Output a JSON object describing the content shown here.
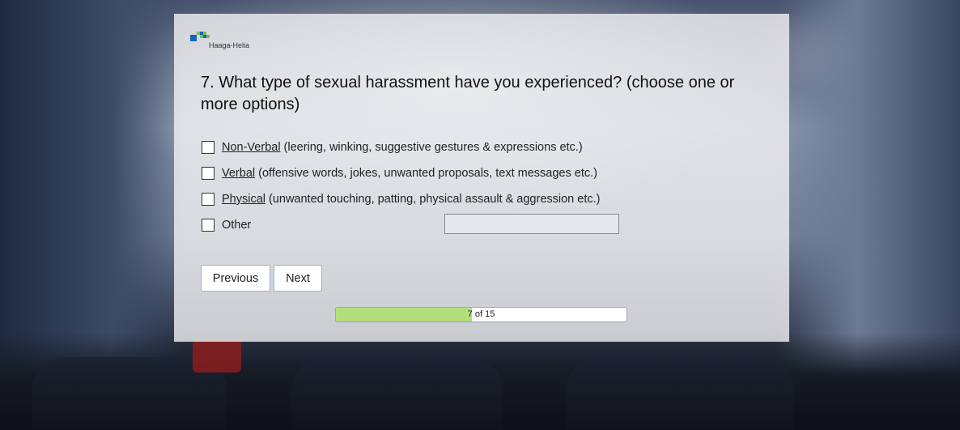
{
  "brand": {
    "name": "Haaga-Helia"
  },
  "question": {
    "text": "7. What type of sexual harassment have you experienced? (choose one or more options)"
  },
  "options": [
    {
      "term": "Non-Verbal",
      "description": "(leering, winking, suggestive gestures & expressions etc.)",
      "checked": false
    },
    {
      "term": "Verbal",
      "description": "(offensive words, jokes, unwanted proposals, text messages etc.)",
      "checked": false
    },
    {
      "term": "Physical",
      "description": "(unwanted touching, patting, physical assault & aggression etc.)",
      "checked": false
    },
    {
      "term": "",
      "description": "Other",
      "checked": false
    }
  ],
  "other_input": {
    "value": "",
    "placeholder": ""
  },
  "buttons": {
    "previous": "Previous",
    "next": "Next"
  },
  "progress": {
    "label": "7 of 15",
    "current": 7,
    "total": 15
  },
  "colors": {
    "progress_fill": "#b3de7e",
    "button_border": "#9bb3d1",
    "logo_blue": "#1565c0",
    "logo_green": "#7cc242"
  },
  "icons": {
    "logo": "haaga-helia-logo-icon",
    "checkbox": "checkbox-icon"
  }
}
